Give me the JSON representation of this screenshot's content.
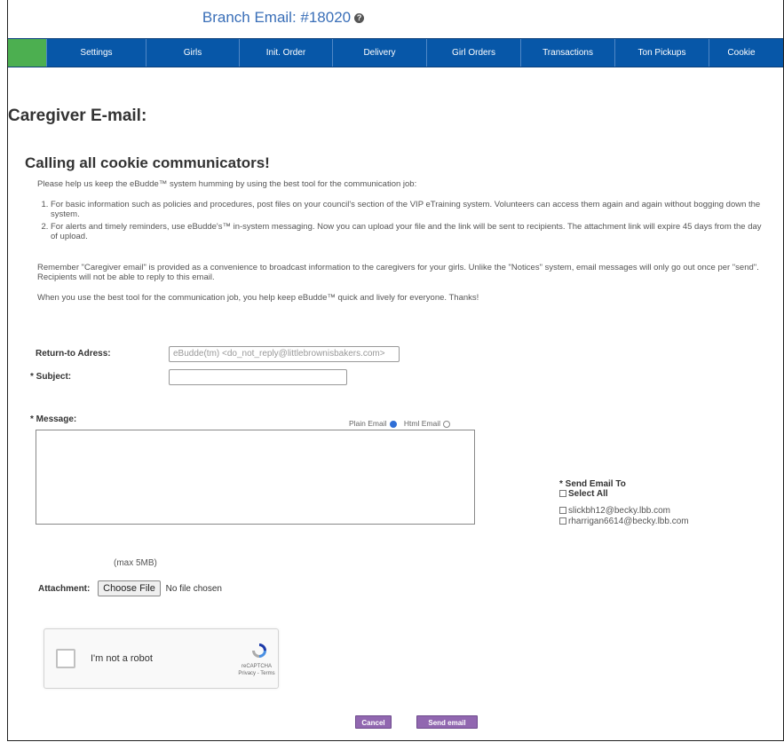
{
  "header": {
    "title": "Branch Email: #18020"
  },
  "nav": {
    "items": [
      "Settings",
      "Girls",
      "Init. Order",
      "Delivery",
      "Girl Orders",
      "Transactions",
      "Ton Pickups",
      "Cookie"
    ]
  },
  "page": {
    "title": "Caregiver E-mail:",
    "subtitle": "Calling all cookie communicators!",
    "intro": "Please help us keep the eBudde™ system humming by using the best tool for the communication job:",
    "list": [
      "For basic information such as policies and procedures, post files on your council's section of the VIP eTraining system. Volunteers can access them again and again without bogging down the system.",
      "For alerts and timely reminders, use eBudde's™ in-system messaging. Now you can upload your file and the link will be sent to recipients. The attachment link will expire 45 days from the day of upload."
    ],
    "remember": "Remember \"Caregiver email\" is provided as a convenience to broadcast information to the caregivers for your girls. Unlike the \"Notices\" system, email messages will only go out once per \"send\". Recipients will not be able to reply to this email.",
    "closing": "When you use the best tool for the communication job, you help keep eBudde™ quick and lively for everyone. Thanks!"
  },
  "form": {
    "return_label": "Return-to Adress:",
    "return_value": "eBudde(tm) <do_not_reply@littlebrownisbakers.com>",
    "subject_label": "Subject:",
    "subject_value": "",
    "message_label": "Message:",
    "plain_label": "Plain Email",
    "html_label": "Html Email",
    "sendto_label": "Send Email To",
    "select_all_label": "Select All",
    "recipients": [
      "slickbh12@becky.lbb.com",
      "rharrigan6614@becky.lbb.com"
    ],
    "max_size": "(max 5MB)",
    "attachment_label": "Attachment:",
    "choose_file": "Choose File",
    "no_file": "No file chosen"
  },
  "captcha": {
    "label": "I'm not a robot",
    "brand": "reCAPTCHA",
    "links": "Privacy - Terms"
  },
  "buttons": {
    "cancel": "Cancel",
    "send": "Send email"
  },
  "colors": {
    "nav_blue": "#0757a8",
    "nav_green": "#4caf50",
    "title_blue": "#3a6fb8",
    "button_purple": "#9167b0"
  }
}
